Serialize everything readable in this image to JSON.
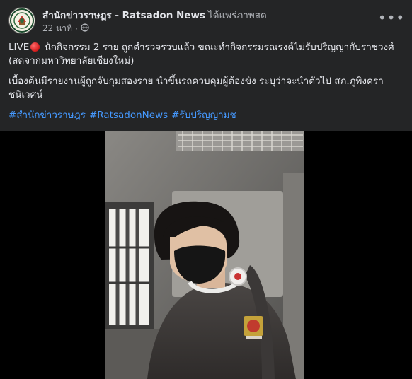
{
  "post": {
    "page_name": "สำนักข่าวราษฎร - Ratsadon News",
    "action": "ได้แพร่ภาพสด",
    "time": "22 นาที",
    "separator": "·",
    "more_label": "•••",
    "live_label": "LIVE",
    "headline": "นักกิจกรรม 2 ราย ถูกตำรวจรวบแล้ว ขณะทำกิจกรรมรณรงค์ไม่รับปริญญากับราชวงศ์ (สดจากมหาวิทยาลัยเชียงใหม่)",
    "paragraph2": "เบื้องต้นมีรายงานผู้ถูกจับกุมสองราย นำขึ้นรถควบคุมผู้ต้องขัง ระบุว่าจะนำตัวไป สภ.ภูพิงคราชนิเวศน์",
    "hashtags": [
      "#สำนักข่าวราษฎร",
      "#RatsadonNews",
      "#รับปริญญามช"
    ]
  },
  "colors": {
    "background": "#242526",
    "text": "#e4e6eb",
    "secondary_text": "#b0b3b8",
    "hashtag": "#4599ff",
    "live_dot": "#e02424"
  },
  "icons": {
    "globe": "globe-icon",
    "more": "more-options-icon",
    "avatar": "page-logo-avatar"
  }
}
